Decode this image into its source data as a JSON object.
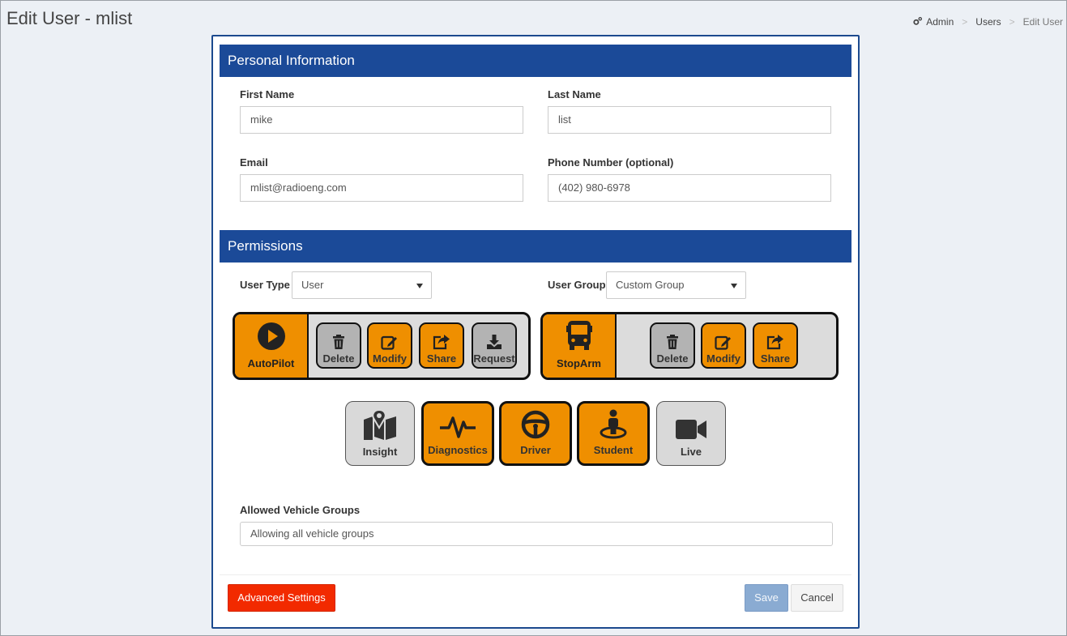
{
  "page": {
    "title": "Edit User - mlist"
  },
  "breadcrumb": {
    "items": [
      "Admin",
      "Users",
      "Edit User"
    ]
  },
  "personal": {
    "header": "Personal Information",
    "first_name": {
      "label": "First Name",
      "value": "mike"
    },
    "last_name": {
      "label": "Last Name",
      "value": "list"
    },
    "email": {
      "label": "Email",
      "value": "mlist@radioeng.com"
    },
    "phone": {
      "label": "Phone Number (optional)",
      "value": "(402) 980-6978"
    }
  },
  "permissions": {
    "header": "Permissions",
    "user_type": {
      "label": "User Type",
      "value": "User"
    },
    "user_group": {
      "label": "User Group",
      "value": "Custom Group"
    },
    "autopilot": {
      "label": "AutoPilot",
      "enabled": true,
      "actions": [
        {
          "label": "Delete",
          "enabled": false
        },
        {
          "label": "Modify",
          "enabled": true
        },
        {
          "label": "Share",
          "enabled": true
        },
        {
          "label": "Request",
          "enabled": false
        }
      ]
    },
    "stoparm": {
      "label": "StopArm",
      "enabled": true,
      "actions": [
        {
          "label": "Delete",
          "enabled": false
        },
        {
          "label": "Modify",
          "enabled": true
        },
        {
          "label": "Share",
          "enabled": true
        }
      ]
    },
    "modules": [
      {
        "label": "Insight",
        "icon": "map-pin-icon",
        "enabled": false
      },
      {
        "label": "Diagnostics",
        "icon": "pulse-icon",
        "enabled": true
      },
      {
        "label": "Driver",
        "icon": "steering-wheel-icon",
        "enabled": true
      },
      {
        "label": "Student",
        "icon": "student-location-icon",
        "enabled": true
      },
      {
        "label": "Live",
        "icon": "video-camera-icon",
        "enabled": false
      }
    ],
    "vehicle_groups": {
      "label": "Allowed Vehicle Groups",
      "value": "Allowing all vehicle groups"
    }
  },
  "footer": {
    "advanced_label": "Advanced Settings",
    "save_label": "Save",
    "cancel_label": "Cancel"
  },
  "colors": {
    "header_blue": "#1b4a98",
    "enabled_orange": "#ef8f00",
    "disabled_gray": "#d9d9d9",
    "danger_red": "#f22a00",
    "save_blue": "#8aabd2"
  }
}
